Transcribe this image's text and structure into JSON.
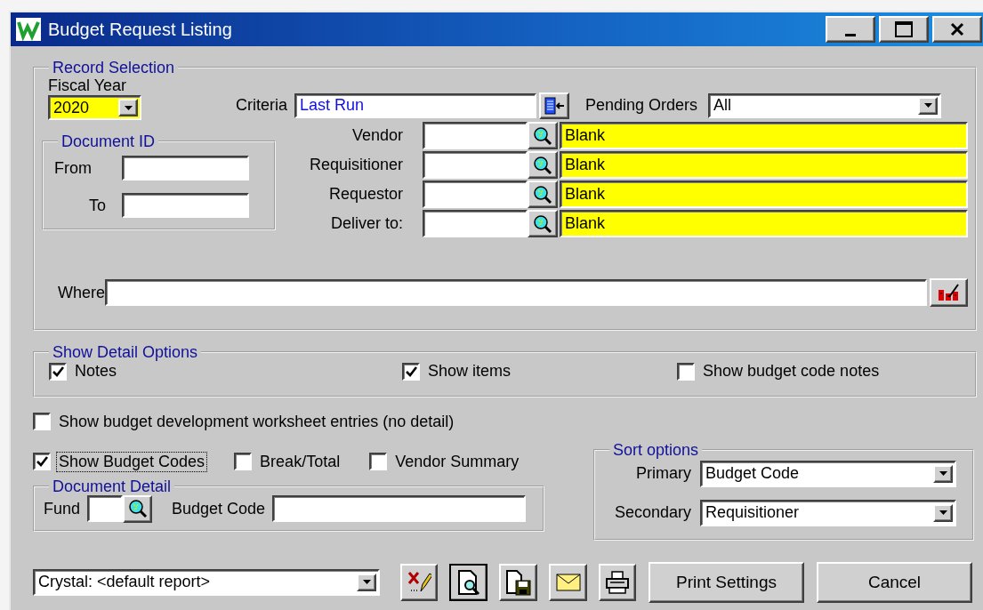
{
  "window": {
    "title": "Budget Request Listing"
  },
  "record_selection": {
    "legend": "Record Selection",
    "fiscal_year": {
      "label": "Fiscal Year",
      "value": "2020"
    },
    "criteria": {
      "label": "Criteria",
      "value": "Last Run"
    },
    "pending_orders": {
      "label": "Pending Orders",
      "value": "All"
    },
    "document_id": {
      "legend": "Document ID",
      "fields": [
        {
          "label": "From"
        },
        {
          "label": "To"
        }
      ]
    },
    "lookups": [
      {
        "label": "Vendor",
        "description": "Blank"
      },
      {
        "label": "Requisitioner",
        "description": "Blank"
      },
      {
        "label": "Requestor",
        "description": "Blank"
      },
      {
        "label": "Deliver to:",
        "description": "Blank"
      }
    ],
    "where": {
      "label": "Where"
    }
  },
  "show_detail_options": {
    "legend": "Show Detail Options",
    "options": [
      {
        "label": "Notes",
        "checked": true
      },
      {
        "label": "Show items",
        "checked": true
      },
      {
        "label": "Show budget code notes",
        "checked": false
      }
    ]
  },
  "worksheet_option": {
    "label": "Show budget development worksheet entries (no detail)",
    "checked": false,
    "focused": false
  },
  "budget_options": [
    {
      "label": "Show Budget Codes",
      "checked": true,
      "focused": true
    },
    {
      "label": "Break/Total",
      "checked": false,
      "focused": false
    },
    {
      "label": "Vendor Summary",
      "checked": false,
      "focused": false
    }
  ],
  "document_detail": {
    "legend": "Document Detail",
    "fund": {
      "label": "Fund"
    },
    "budget_code": {
      "label": "Budget Code"
    }
  },
  "sort_options": {
    "legend": "Sort options",
    "fields": [
      {
        "label": "Primary",
        "value": "Budget Code"
      },
      {
        "label": "Secondary",
        "value": "Requisitioner"
      }
    ]
  },
  "report": {
    "value": "Crystal: <default report>"
  },
  "buttons": [
    {
      "label": "Print Settings"
    },
    {
      "label": "Cancel"
    }
  ]
}
